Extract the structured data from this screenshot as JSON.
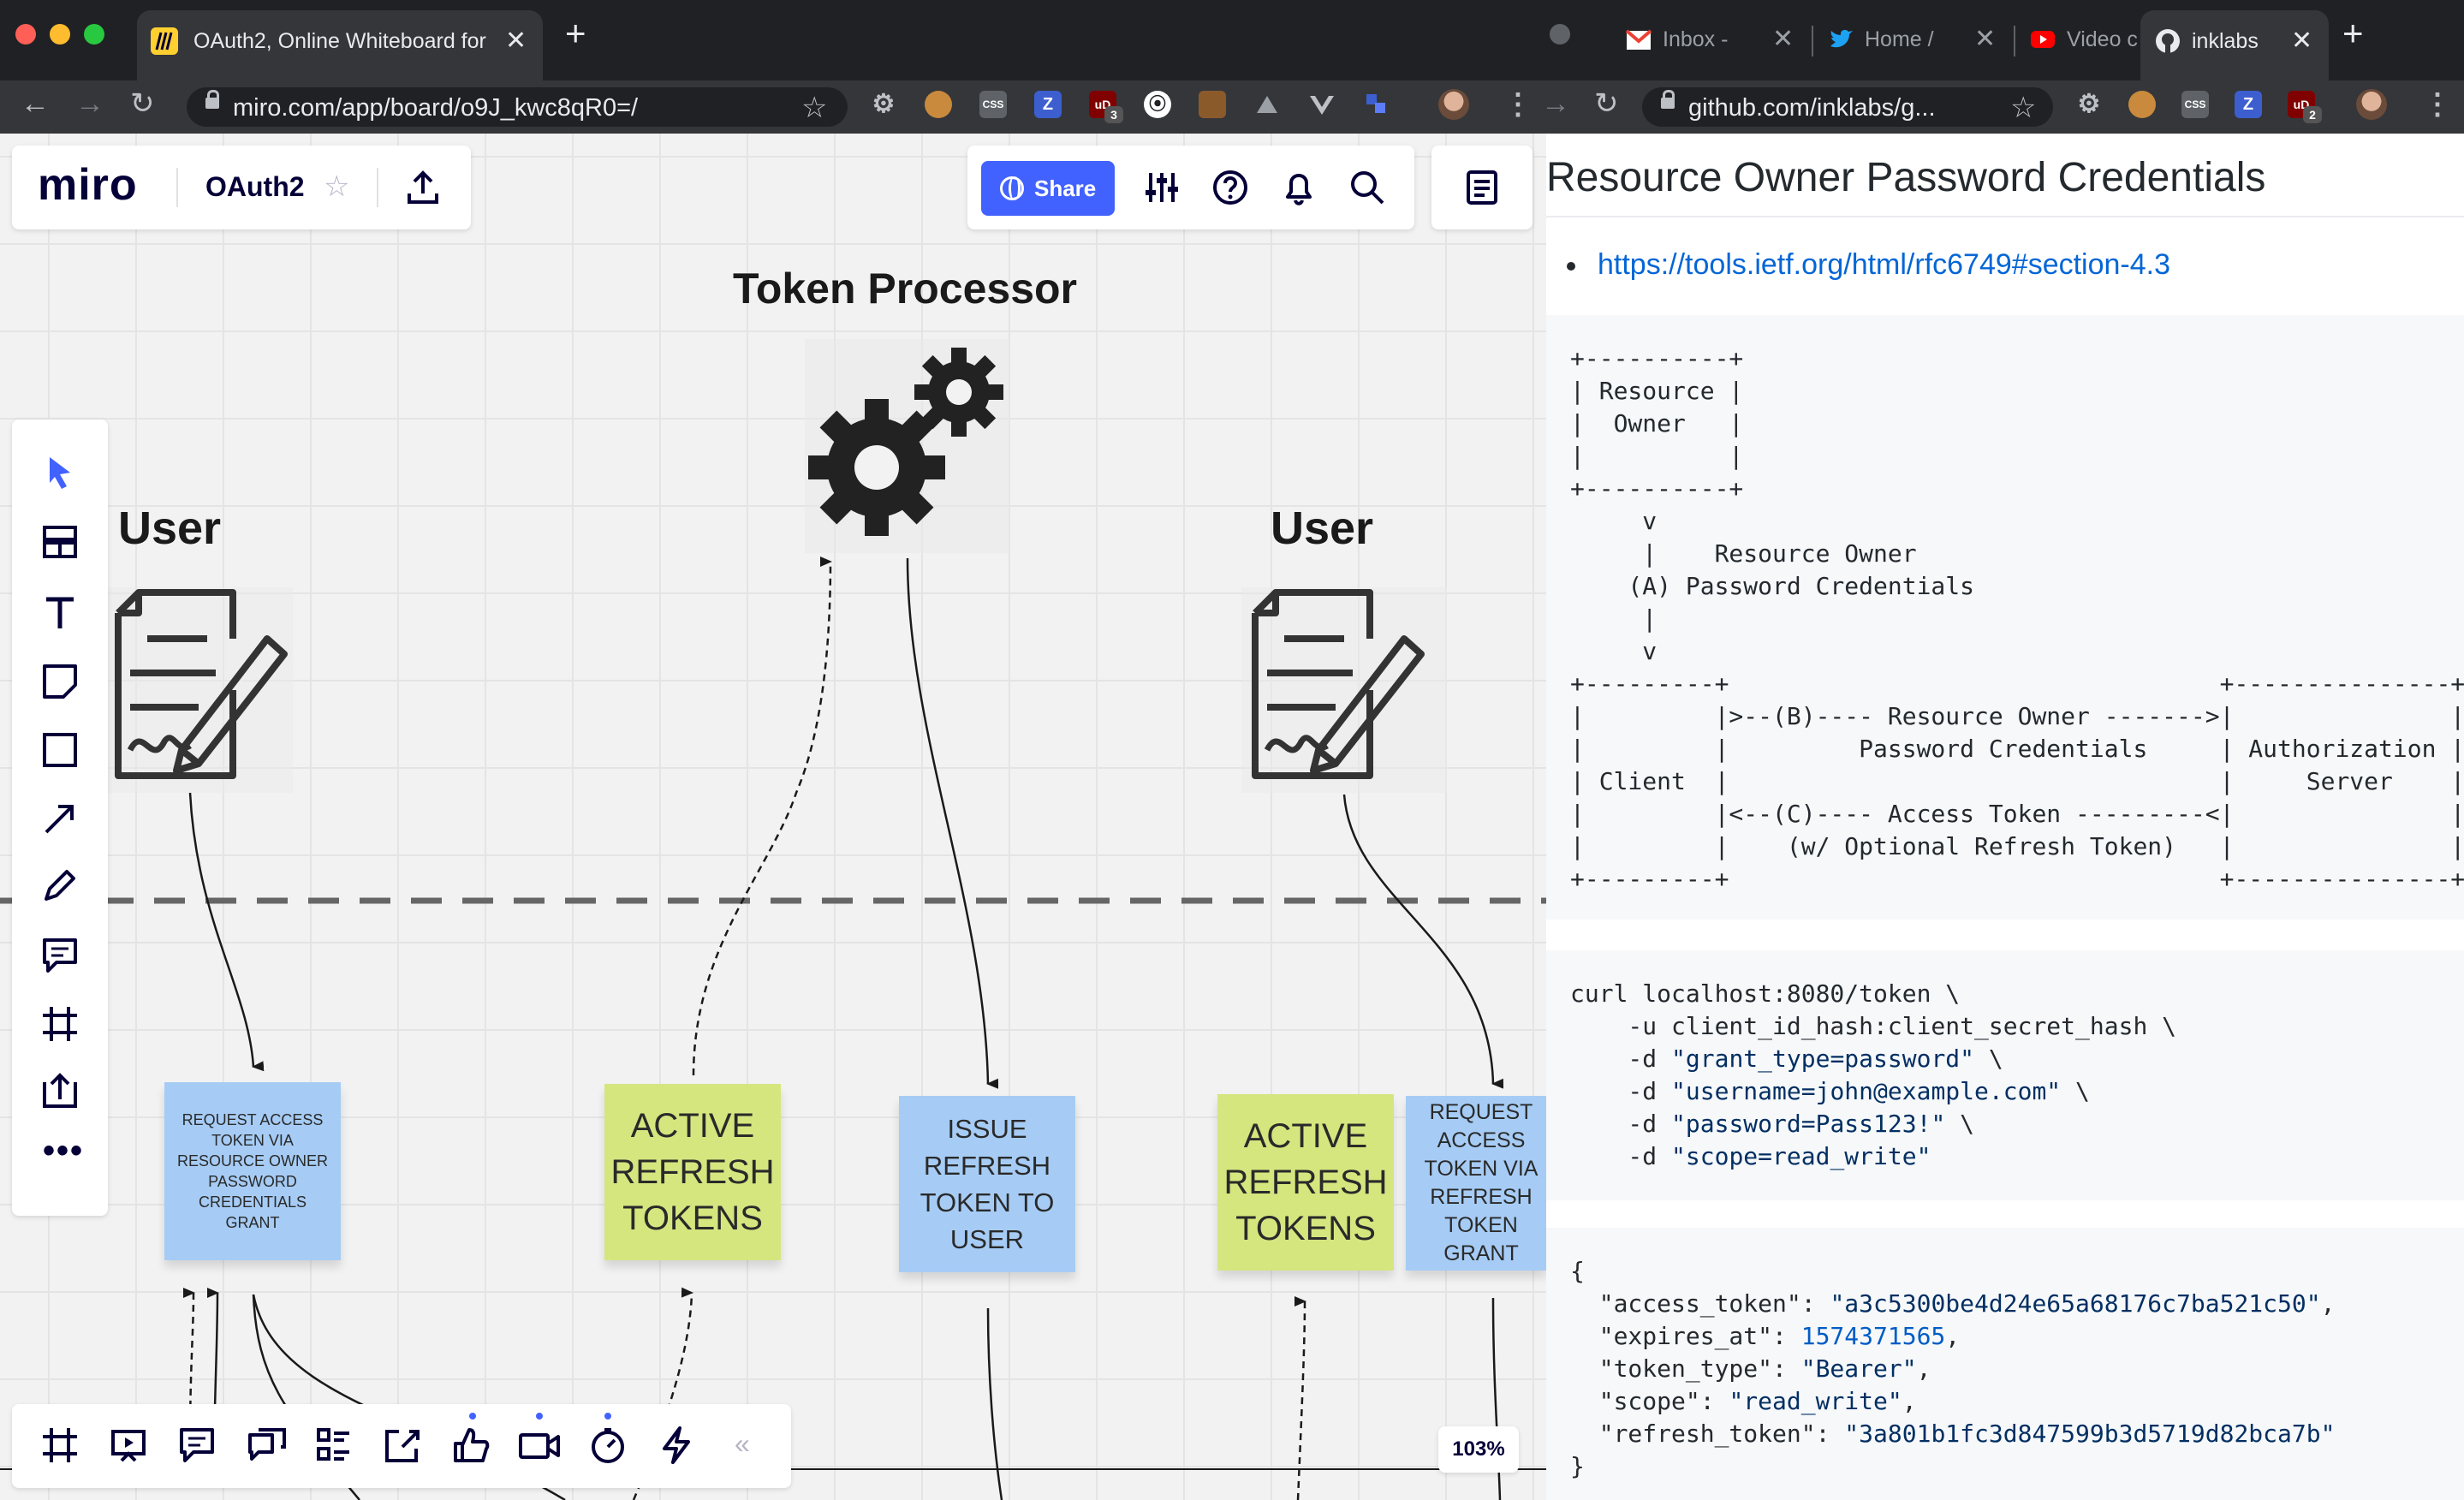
{
  "browser_left": {
    "tab_active": {
      "title": "OAuth2, Online Whiteboard for"
    },
    "url": "miro.com/app/board/o9J_kwc8qR0=/",
    "ext_badges": {
      "ublock": "3"
    }
  },
  "browser_right": {
    "tabs": [
      {
        "title": "Inbox -"
      },
      {
        "title": "Home /"
      },
      {
        "title": "Video c"
      },
      {
        "title": "inklabs"
      }
    ],
    "url": "github.com/inklabs/g...",
    "ext_badges": {
      "ublock": "2"
    }
  },
  "miro": {
    "logo": "miro",
    "board_name": "OAuth2",
    "share_label": "Share",
    "zoom": "103%",
    "headings": {
      "token_processor": "Token Processor",
      "user_left": "User",
      "user_right": "User"
    },
    "stickies": [
      {
        "text": "REQUEST ACCESS TOKEN VIA RESOURCE OWNER PASSWORD CREDENTIALS GRANT",
        "color": "#a6ccf5"
      },
      {
        "text": "ACTIVE REFRESH TOKENS",
        "color": "#d5e67f"
      },
      {
        "text": "ISSUE REFRESH TOKEN TO USER",
        "color": "#a6ccf5"
      },
      {
        "text": "ACTIVE REFRESH TOKENS",
        "color": "#d5e67f"
      },
      {
        "text": "REQUEST ACCESS TOKEN VIA REFRESH TOKEN GRANT",
        "color": "#a6ccf5"
      }
    ],
    "brand_color": "#4262ff"
  },
  "github": {
    "heading": "Resource Owner Password Credentials",
    "link": "https://tools.ietf.org/html/rfc6749#section-4.3",
    "diagram": "+----------+\n| Resource |\n|  Owner   |\n|          |\n+----------+\n     v\n     |    Resource Owner\n    (A) Password Credentials\n     |\n     v\n+---------+                                  +---------------+\n|         |>--(B)---- Resource Owner ------->|               |\n|         |         Password Credentials     | Authorization |\n| Client  |                                  |     Server    |\n|         |<--(C)---- Access Token ---------<|               |\n|         |    (w/ Optional Refresh Token)   |               |\n+---------+                                  +---------------+",
    "curl": [
      {
        "plain": "curl localhost:8080/token \\"
      },
      {
        "plain": "    -u client_id_hash:client_secret_hash \\"
      },
      {
        "pre": "    -d ",
        "str": "\"grant_type=password\"",
        "post": " \\"
      },
      {
        "pre": "    -d ",
        "str": "\"username=john@example.com\"",
        "post": " \\"
      },
      {
        "pre": "    -d ",
        "str": "\"password=Pass123!\"",
        "post": " \\"
      },
      {
        "pre": "    -d ",
        "str": "\"scope=read_write\"",
        "post": ""
      }
    ],
    "json": {
      "open": "{",
      "access_token_key": "  \"access_token\": ",
      "access_token_val": "\"a3c5300be4d24e65a68176c7ba521c50\"",
      "expires_at_key": "  \"expires_at\": ",
      "expires_at_val": "1574371565",
      "token_type_key": "  \"token_type\": ",
      "token_type_val": "\"Bearer\"",
      "scope_key": "  \"scope\": ",
      "scope_val": "\"read_write\"",
      "refresh_token_key": "  \"refresh_token\": ",
      "refresh_token_val": "\"3a801b1fc3d847599b3d5719d82bca7b\"",
      "close": "}"
    }
  }
}
